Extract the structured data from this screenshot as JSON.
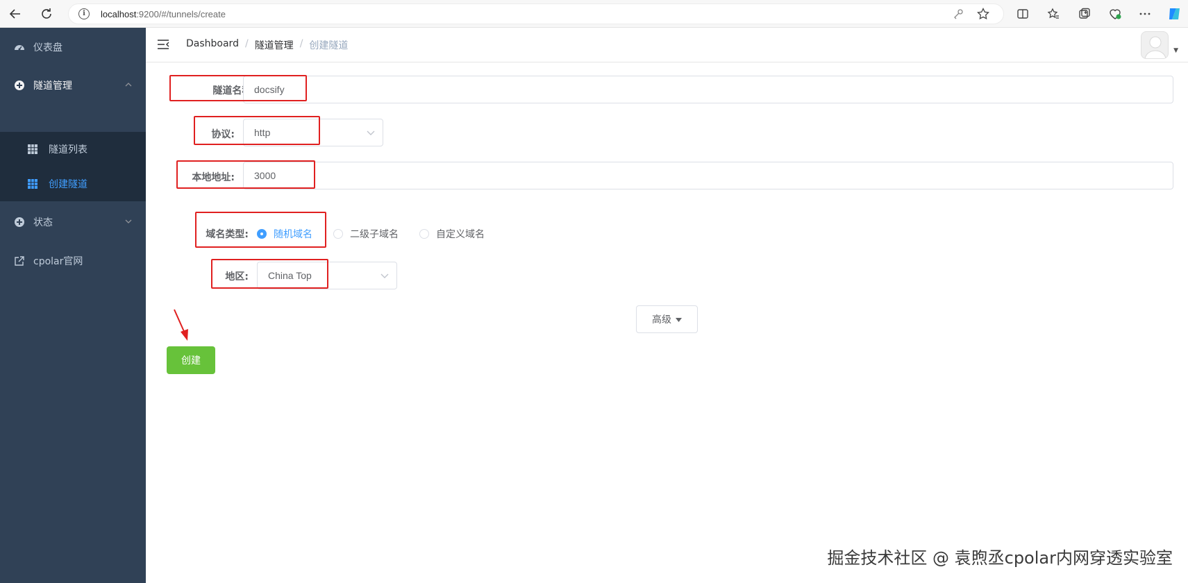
{
  "browser": {
    "url_host": "localhost",
    "url_path": ":9200/#/tunnels/create"
  },
  "sidebar": {
    "items": [
      {
        "label": "仪表盘",
        "icon": "dashboard-icon"
      },
      {
        "label": "隧道管理",
        "icon": "tunnel-icon",
        "expanded": true
      },
      {
        "label": "状态",
        "icon": "status-icon",
        "expanded": false
      },
      {
        "label": "cpolar官网",
        "icon": "external-link-icon"
      }
    ],
    "submenu": [
      {
        "label": "隧道列表",
        "icon": "grid-icon",
        "active": false
      },
      {
        "label": "创建隧道",
        "icon": "grid-icon",
        "active": true
      }
    ]
  },
  "header": {
    "breadcrumb": [
      "Dashboard",
      "隧道管理",
      "创建隧道"
    ],
    "separator": "/"
  },
  "form": {
    "name_label": "隧道名称:",
    "name_value": "docsify",
    "protocol_label": "协议:",
    "protocol_value": "http",
    "address_label": "本地地址:",
    "address_value": "3000",
    "domain_type_label": "域名类型:",
    "domain_type_options": [
      "随机域名",
      "二级子域名",
      "自定义域名"
    ],
    "domain_type_selected": "随机域名",
    "region_label": "地区:",
    "region_value": "China Top",
    "advanced_label": "高级",
    "create_label": "创建"
  },
  "watermark": "掘金技术社区 @ 袁煦丞cpolar内网穿透实验室",
  "colors": {
    "sidebar_bg": "#304156",
    "submenu_bg": "#1f2d3d",
    "active": "#409eff",
    "create_button": "#67c23a",
    "highlight_box": "#e02020"
  }
}
